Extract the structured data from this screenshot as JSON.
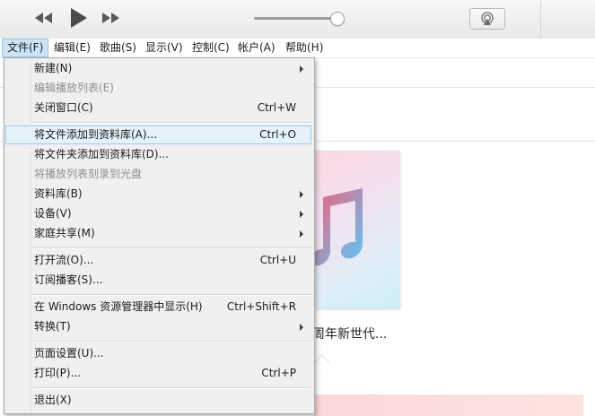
{
  "menubar": {
    "items": [
      {
        "label": "文件(F)",
        "active": true
      },
      {
        "label": "编辑(E)"
      },
      {
        "label": "歌曲(S)"
      },
      {
        "label": "显示(V)"
      },
      {
        "label": "控制(C)"
      },
      {
        "label": "帐户(A)"
      },
      {
        "label": "帮助(H)"
      }
    ]
  },
  "player": {
    "volume_level": 0.92,
    "icons": [
      "rewind-icon",
      "play-icon",
      "fast-forward-icon",
      "airplay-icon"
    ]
  },
  "file_menu": {
    "items": [
      {
        "label": "新建(N)",
        "shortcut": "",
        "submenu": true,
        "disabled": false
      },
      {
        "label": "编辑播放列表(E)",
        "shortcut": "",
        "submenu": false,
        "disabled": true
      },
      {
        "label": "关闭窗口(C)",
        "shortcut": "Ctrl+W",
        "submenu": false,
        "disabled": false
      },
      {
        "label": "将文件添加到资料库(A)...",
        "shortcut": "Ctrl+O",
        "submenu": false,
        "disabled": false,
        "highlighted": true
      },
      {
        "label": "将文件夹添加到资料库(D)...",
        "shortcut": "",
        "submenu": false,
        "disabled": false
      },
      {
        "label": "将播放列表刻录到光盘",
        "shortcut": "",
        "submenu": false,
        "disabled": true
      },
      {
        "label": "资料库(B)",
        "shortcut": "",
        "submenu": true,
        "disabled": false
      },
      {
        "label": "设备(V)",
        "shortcut": "",
        "submenu": true,
        "disabled": false
      },
      {
        "label": "家庭共享(M)",
        "shortcut": "",
        "submenu": true,
        "disabled": false
      },
      {
        "label": "打开流(O)...",
        "shortcut": "Ctrl+U",
        "submenu": false,
        "disabled": false
      },
      {
        "label": "订阅播客(S)...",
        "shortcut": "",
        "submenu": false,
        "disabled": false
      },
      {
        "label": "在 Windows 资源管理器中显示(H)",
        "shortcut": "Ctrl+Shift+R",
        "submenu": false,
        "disabled": false
      },
      {
        "label": "转换(T)",
        "shortcut": "",
        "submenu": true,
        "disabled": false
      },
      {
        "label": "页面设置(U)...",
        "shortcut": "",
        "submenu": false,
        "disabled": false
      },
      {
        "label": "打印(P)...",
        "shortcut": "Ctrl+P",
        "submenu": false,
        "disabled": false
      },
      {
        "label": "退出(X)",
        "shortcut": "",
        "submenu": false,
        "disabled": false
      }
    ]
  },
  "content": {
    "album_title": "周年新世代..."
  },
  "colors": {
    "highlight_bg": "#e5f1fb",
    "highlight_border": "#9ccbf0",
    "menubar_active_bg": "#cce4f7",
    "disabled_text": "#8d8d8d",
    "music_icon_gradient": [
      "#fb5c74",
      "#5ac8fa"
    ]
  }
}
